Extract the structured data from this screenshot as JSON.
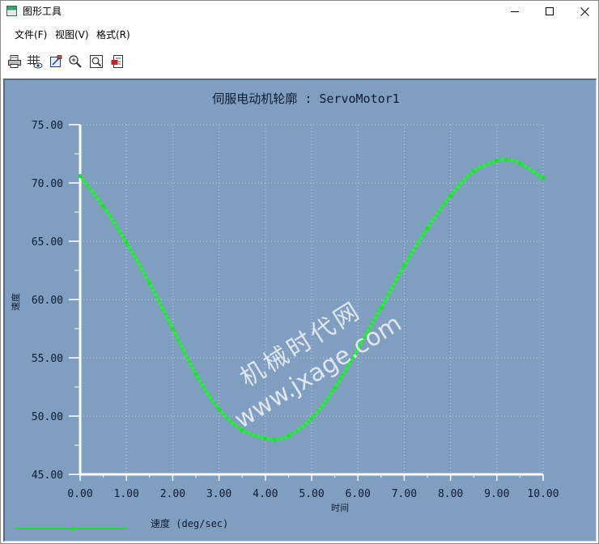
{
  "window": {
    "title": "图形工具",
    "controls": {
      "minimize": "minimize",
      "maximize": "maximize",
      "close": "close"
    }
  },
  "menu": {
    "items": [
      {
        "label": "文件(F)"
      },
      {
        "label": "视图(V)"
      },
      {
        "label": "格式(R)"
      }
    ]
  },
  "toolbar": {
    "tools": [
      {
        "icon": "print-icon"
      },
      {
        "icon": "grid-eye-icon"
      },
      {
        "icon": "format-icon"
      },
      {
        "icon": "zoom-in-icon"
      },
      {
        "icon": "refit-icon"
      },
      {
        "icon": "export-icon"
      }
    ]
  },
  "watermark": {
    "line1": "机械时代网",
    "line2": "www.jxage.com"
  },
  "chart_data": {
    "type": "line",
    "title": "伺服电动机轮廓  :  ServoMotor1",
    "xlabel": "时间",
    "ylabel": "速度",
    "xlim": [
      0,
      10
    ],
    "ylim": [
      45,
      75
    ],
    "x_ticks": [
      "0.00",
      "1.00",
      "2.00",
      "3.00",
      "4.00",
      "5.00",
      "6.00",
      "7.00",
      "8.00",
      "9.00",
      "10.00"
    ],
    "y_ticks": [
      "45.00",
      "50.00",
      "55.00",
      "60.00",
      "65.00",
      "70.00",
      "75.00"
    ],
    "grid": true,
    "legend_position": "bottom-left",
    "series": [
      {
        "name": "速度 (deg/sec)",
        "color": "#22dd33",
        "x": [
          0.0,
          0.5,
          1.0,
          1.5,
          2.0,
          2.5,
          3.0,
          3.5,
          4.0,
          4.2,
          4.5,
          5.0,
          5.5,
          6.0,
          6.5,
          7.0,
          7.5,
          8.0,
          8.5,
          9.0,
          9.2,
          9.5,
          10.0
        ],
        "y": [
          70.6,
          68.0,
          64.9,
          61.4,
          57.5,
          53.6,
          50.6,
          48.8,
          48.1,
          48.0,
          48.3,
          49.8,
          52.4,
          55.8,
          59.3,
          62.9,
          66.1,
          68.9,
          71.0,
          71.9,
          72.0,
          71.7,
          70.4
        ]
      }
    ]
  }
}
